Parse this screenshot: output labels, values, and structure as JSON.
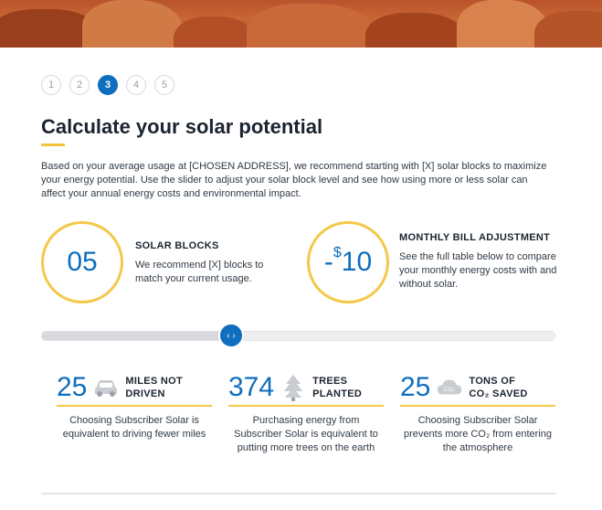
{
  "steps": [
    "1",
    "2",
    "3",
    "4",
    "5"
  ],
  "active_step": "3",
  "title": "Calculate your solar potential",
  "intro": {
    "p1": "Based on your average usage at ",
    "address": "[CHOSEN ADDRESS]",
    "p2": ", we recommend starting with ",
    "x": "[X]",
    "p3": " solar blocks to maximize your energy potential. Use the slider to adjust your solar block level and see how using more or less solar can affect your annual energy costs and environmental impact."
  },
  "solar_blocks": {
    "value": "05",
    "heading": "SOLAR BLOCKS",
    "body_1": "We recommend ",
    "body_x": "[X]",
    "body_2": " blocks to match your current usage."
  },
  "bill_adjustment": {
    "prefix": "-",
    "currency": "$",
    "value": "10",
    "heading": "MONTHLY BILL ADJUSTMENT",
    "body": "See the full table below to compare your monthly energy costs with and without solar."
  },
  "slider": {
    "level": 0.37,
    "thumb_glyph": "‹ ›"
  },
  "stats": [
    {
      "value": "25",
      "icon": "car-icon",
      "label_1": "MILES NOT",
      "label_2": "DRIVEN",
      "desc": "Choosing Subscriber Solar is equivalent to driving fewer miles"
    },
    {
      "value": "374",
      "icon": "tree-icon",
      "label_1": "TREES",
      "label_2": "PLANTED",
      "desc": "Purchasing energy from Subscriber Solar is equivalent to putting more trees on the earth"
    },
    {
      "value": "25",
      "icon": "co2-cloud-icon",
      "label_1": "TONS OF",
      "label_2": "CO₂ SAVED",
      "desc": "Choosing Subscriber Solar prevents more CO₂ from entering the atmosphere"
    }
  ],
  "colors": {
    "accent_blue": "#0f6ebd",
    "accent_yellow": "#f4c84a"
  }
}
